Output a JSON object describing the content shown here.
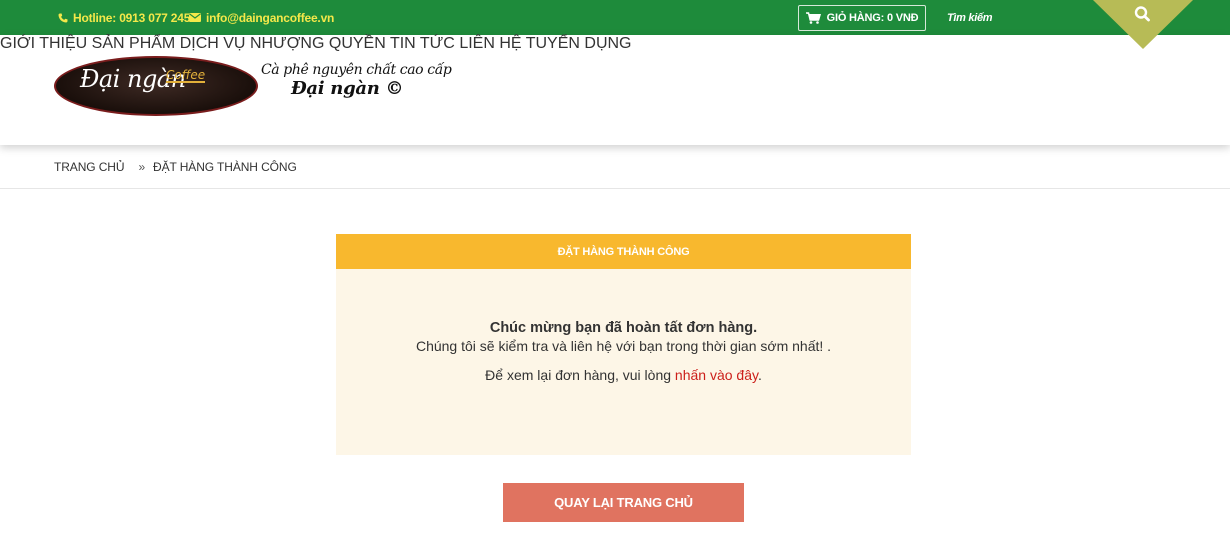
{
  "topbar": {
    "hotline": "Hotline: 0913 077 245",
    "email": "info@daingancoffee.vn",
    "cart_label": "GIỎ HÀNG: 0 VNĐ",
    "search_label": "Tìm kiếm"
  },
  "logo": {
    "name": "Đại ngàn",
    "coffee": "Coffee",
    "tagline_line1": "Cà phê nguyên chất cao cấp",
    "tagline_line2": "Đại ngàn ©"
  },
  "nav": {
    "items": [
      {
        "label": "GIỚI THIỆU"
      },
      {
        "label": "SẢN PHẨM"
      },
      {
        "label": "DỊCH VỤ"
      },
      {
        "label": "NHƯỢNG QUYỀN"
      },
      {
        "label": "TIN TỨC"
      },
      {
        "label": "LIÊN HỆ"
      },
      {
        "label": "TUYỂN DỤNG"
      }
    ]
  },
  "breadcrumb": {
    "home": "TRANG CHỦ",
    "separator": "»",
    "current": "ĐẶT HÀNG THÀNH CÔNG"
  },
  "success": {
    "title": "ĐẶT HÀNG THÀNH CÔNG",
    "congrats": "Chúc mừng bạn đã hoàn tất đơn hàng.",
    "followup": "Chúng tôi sẽ kiểm tra và liên hệ với bạn trong thời gian sớm nhất! .",
    "view_order_prefix": "Để xem lại đơn hàng, vui lòng ",
    "view_order_link": "nhấn vào đây",
    "view_order_suffix": "."
  },
  "home_button_label": "QUAY LẠI TRANG CHỦ",
  "colors": {
    "topbar_green": "#1e8b3b",
    "topbar_text_yellow": "#f4e84a",
    "search_tab_olive": "#b7bb56",
    "success_header": "#f8b82e",
    "success_bg": "#fdf6e7",
    "link_red": "#cc1f1a",
    "button_coral": "#e07360"
  },
  "icons": [
    "phone-icon",
    "envelope-icon",
    "cart-icon",
    "search-icon"
  ]
}
